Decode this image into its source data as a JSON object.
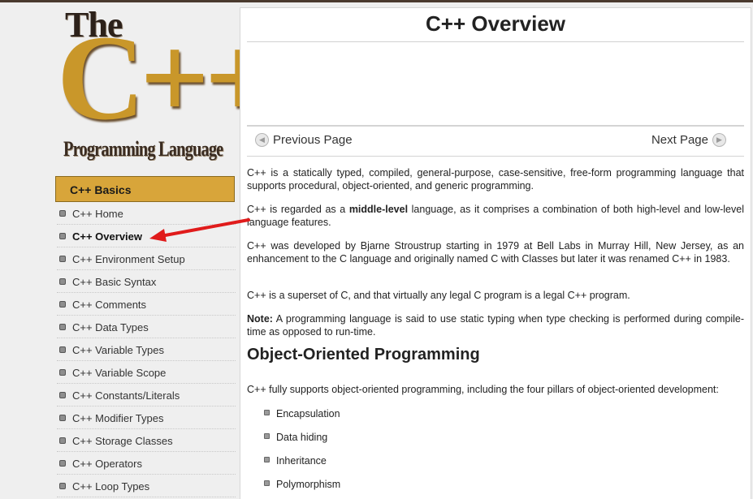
{
  "logo": {
    "line1": "The",
    "line2": "C++",
    "line3": "Programming Language"
  },
  "sidebar": {
    "section_title": "C++ Basics",
    "items": [
      {
        "label": "C++ Home",
        "active": false
      },
      {
        "label": "C++ Overview",
        "active": true
      },
      {
        "label": "C++ Environment Setup",
        "active": false
      },
      {
        "label": "C++ Basic Syntax",
        "active": false
      },
      {
        "label": "C++ Comments",
        "active": false
      },
      {
        "label": "C++ Data Types",
        "active": false
      },
      {
        "label": "C++ Variable Types",
        "active": false
      },
      {
        "label": "C++ Variable Scope",
        "active": false
      },
      {
        "label": "C++ Constants/Literals",
        "active": false
      },
      {
        "label": "C++ Modifier Types",
        "active": false
      },
      {
        "label": "C++ Storage Classes",
        "active": false
      },
      {
        "label": "C++ Operators",
        "active": false
      },
      {
        "label": "C++ Loop Types",
        "active": false
      }
    ]
  },
  "main": {
    "title": "C++ Overview",
    "pager": {
      "prev": "Previous Page",
      "next": "Next Page"
    },
    "paragraphs": {
      "p1": "C++ is a statically typed, compiled, general-purpose, case-sensitive, free-form programming language that supports procedural, object-oriented, and generic programming.",
      "p2_a": "C++ is regarded as a ",
      "p2_b": "middle-level",
      "p2_c": " language, as it comprises a combination of both high-level and low-level language features.",
      "p3": "C++ was developed by Bjarne Stroustrup starting in 1979 at Bell Labs in Murray Hill, New Jersey, as an enhancement to the C language and originally named C with Classes but later it was renamed C++ in 1983.",
      "p4": "C++ is a superset of C, and that virtually any legal C program is a legal C++ program.",
      "p5_label": "Note:",
      "p5_text": " A programming language is said to use static typing when type checking is performed during compile-time as opposed to run-time."
    },
    "oop_heading": "Object-Oriented Programming",
    "oop_intro": "C++ fully supports object-oriented programming, including the four pillars of object-oriented development:",
    "pillars": [
      "Encapsulation",
      "Data hiding",
      "Inheritance",
      "Polymorphism"
    ]
  },
  "colors": {
    "accent": "#d8a53a",
    "logo_gold": "#c9972a",
    "arrow": "#e01b1b"
  },
  "icons": {
    "prev": "circle-left-arrow-icon",
    "next": "circle-right-arrow-icon"
  }
}
